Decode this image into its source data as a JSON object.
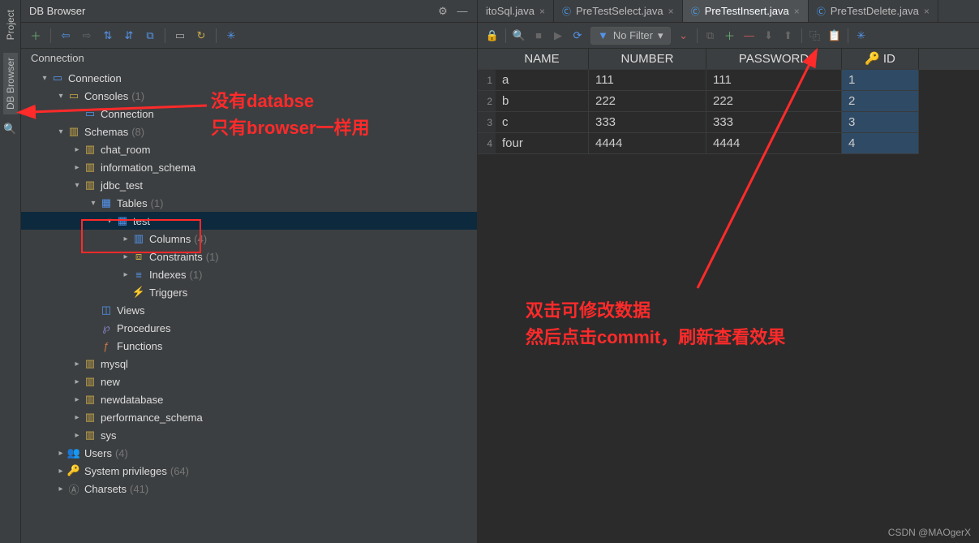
{
  "sideTabs": {
    "project": "Project",
    "dbBrowser": "DB Browser"
  },
  "panel": {
    "title": "DB Browser",
    "section": "Connection"
  },
  "toolbar": {
    "filter": "No Filter"
  },
  "tree": {
    "connection": "Connection",
    "consoles": "Consoles",
    "consolesCount": "(1)",
    "connectionLeaf": "Connection",
    "schemas": "Schemas",
    "schemasCount": "(8)",
    "chat_room": "chat_room",
    "information_schema": "information_schema",
    "jdbc_test": "jdbc_test",
    "tables": "Tables",
    "tablesCount": "(1)",
    "test": "test",
    "columns": "Columns",
    "columnsCount": "(4)",
    "constraints": "Constraints",
    "constraintsCount": "(1)",
    "indexes": "Indexes",
    "indexesCount": "(1)",
    "triggers": "Triggers",
    "views": "Views",
    "procedures": "Procedures",
    "functions": "Functions",
    "mysql": "mysql",
    "new": "new",
    "newdatabase": "newdatabase",
    "performance_schema": "performance_schema",
    "sys": "sys",
    "users": "Users",
    "usersCount": "(4)",
    "systemPrivileges": "System privileges",
    "systemPrivilegesCount": "(64)",
    "charsets": "Charsets",
    "charsetsCount": "(41)"
  },
  "tabs": [
    {
      "label": "itoSql.java",
      "active": false
    },
    {
      "label": "PreTestSelect.java",
      "active": false
    },
    {
      "label": "PreTestInsert.java",
      "active": true
    },
    {
      "label": "PreTestDelete.java",
      "active": false
    }
  ],
  "grid": {
    "headers": {
      "name": "NAME",
      "number": "NUMBER",
      "password": "PASSWORD",
      "id": "ID"
    },
    "rows": [
      {
        "n": "1",
        "name": "a",
        "number": "111",
        "password": "111",
        "id": "1"
      },
      {
        "n": "2",
        "name": "b",
        "number": "222",
        "password": "222",
        "id": "2"
      },
      {
        "n": "3",
        "name": "c",
        "number": "333",
        "password": "333",
        "id": "3"
      },
      {
        "n": "4",
        "name": "four",
        "number": "4444",
        "password": "4444",
        "id": "4"
      }
    ]
  },
  "annotations": {
    "left1": "没有databse",
    "left2": "只有browser一样用",
    "right1": "双击可修改数据",
    "right2": "然后点击commit，刷新查看效果"
  },
  "watermark": "CSDN @MAOgerX"
}
